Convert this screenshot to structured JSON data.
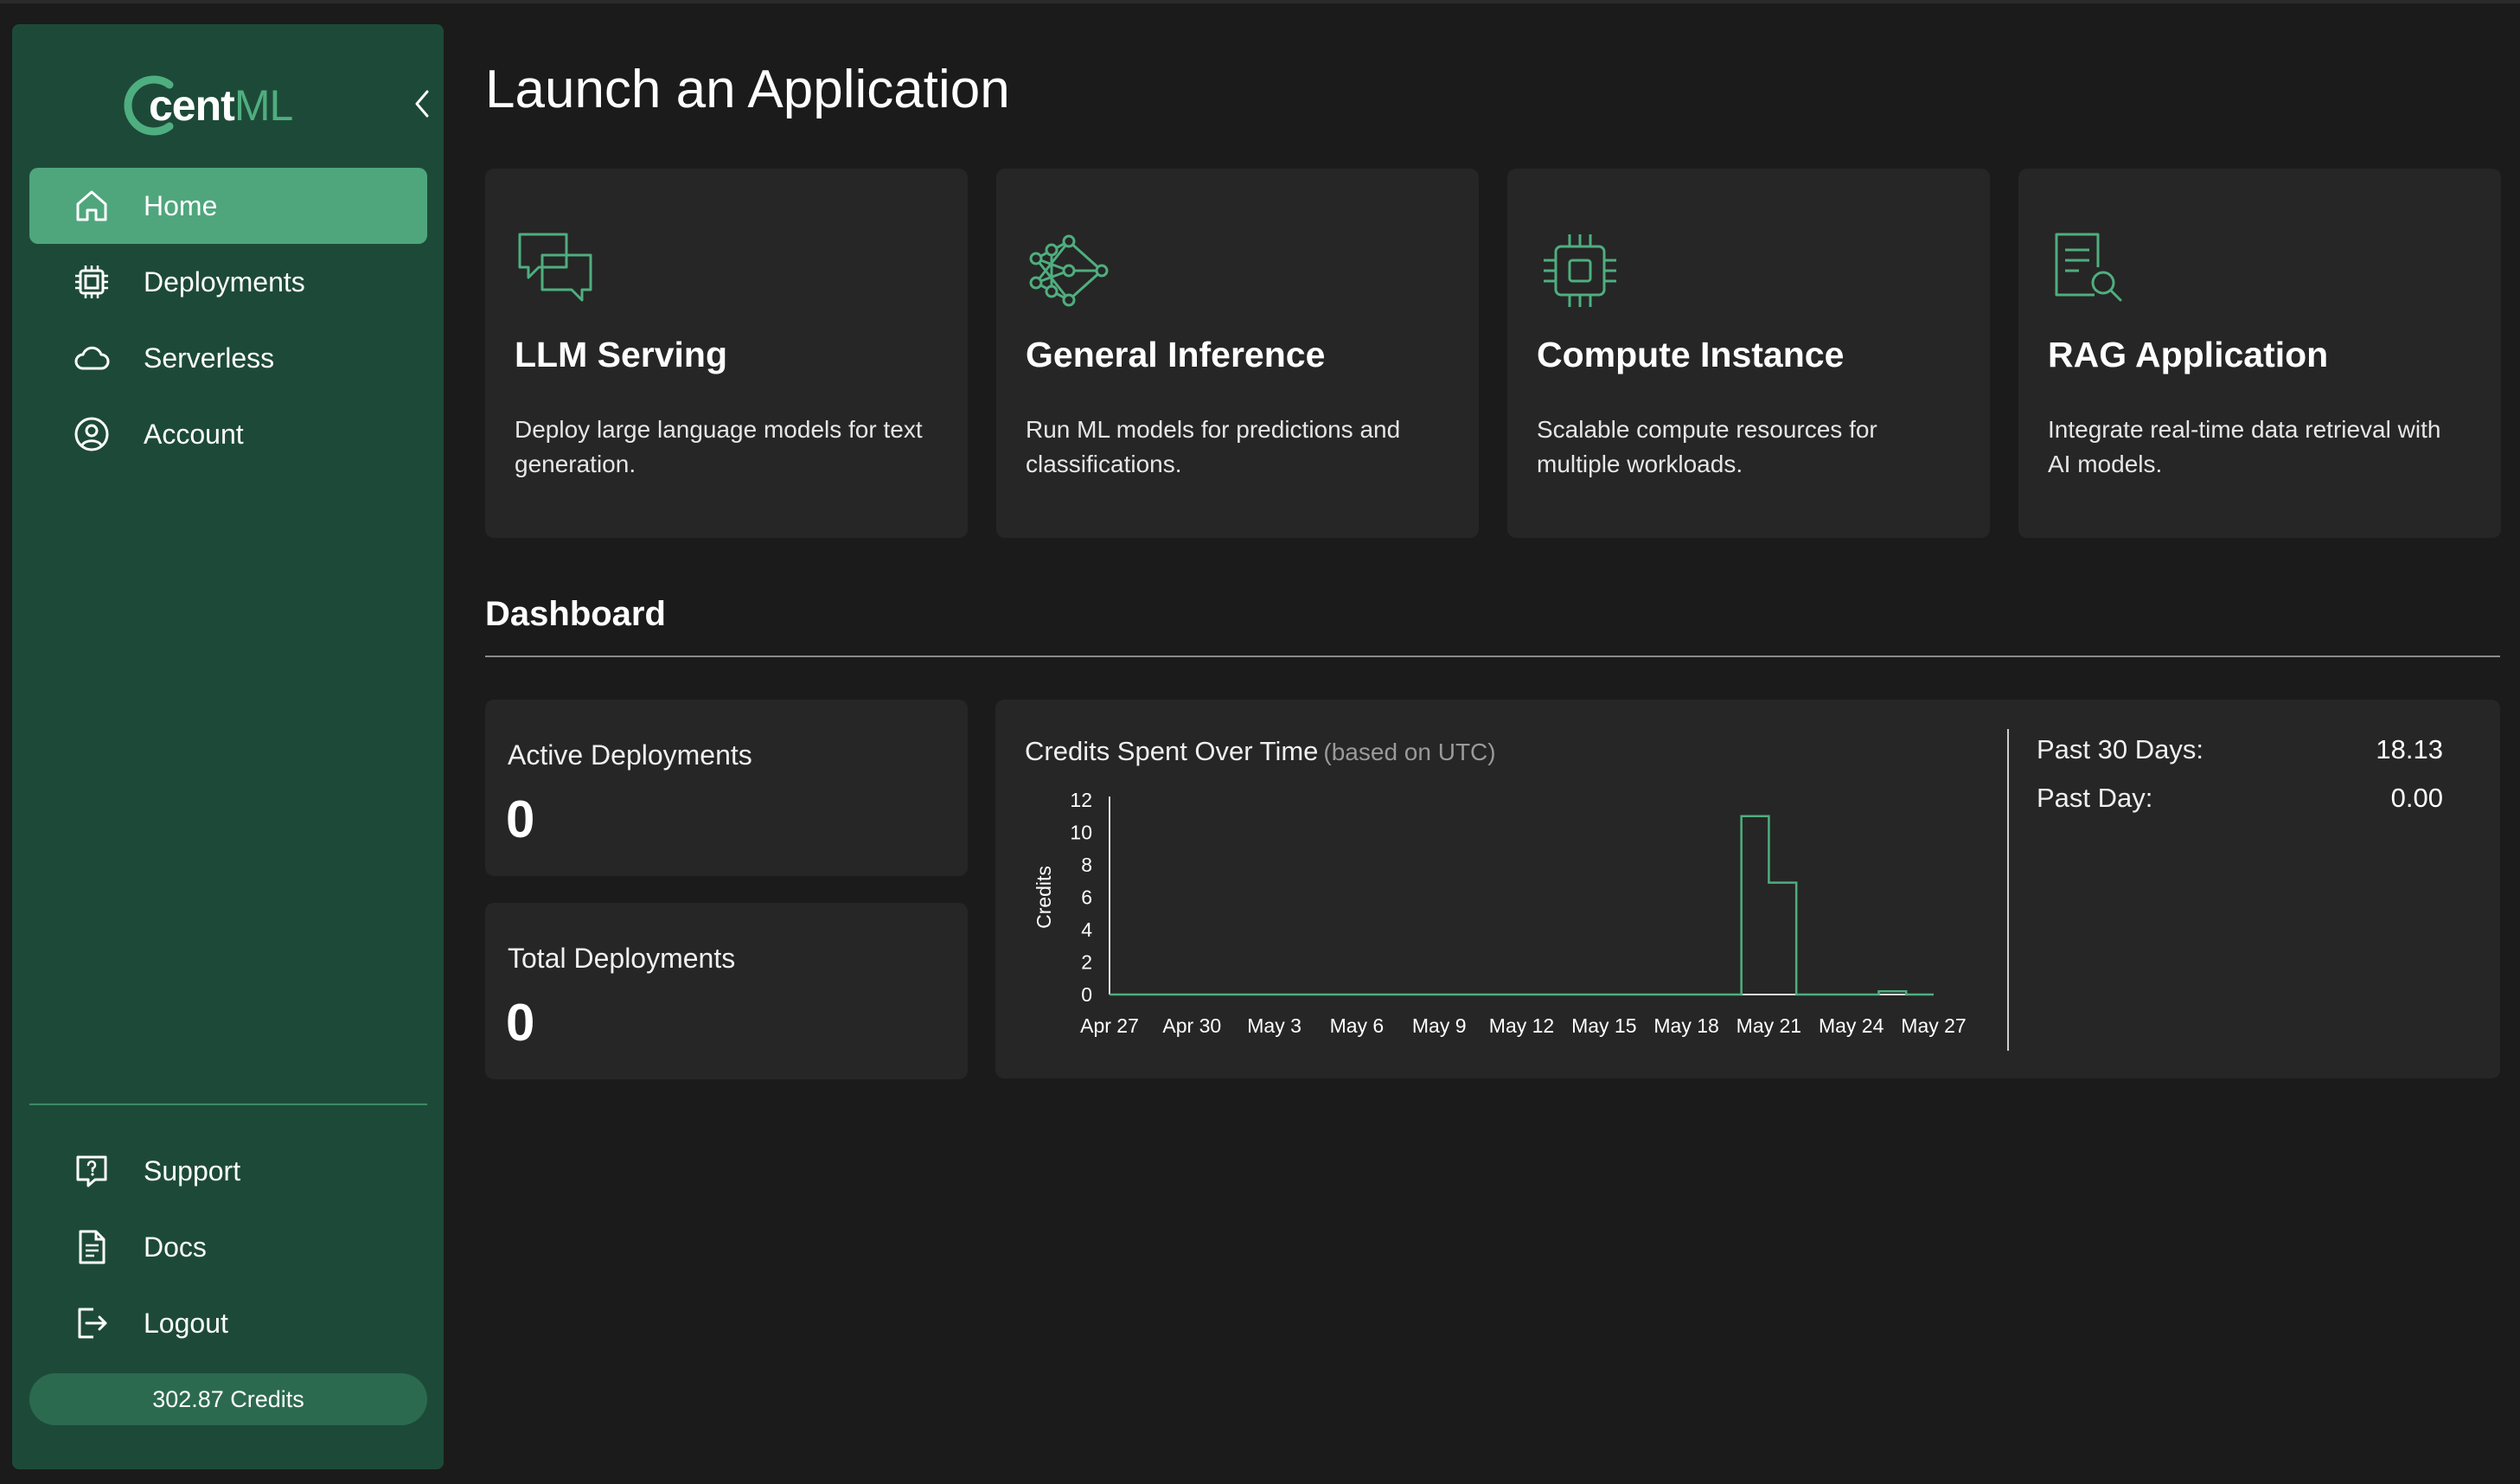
{
  "sidebar": {
    "logo": {
      "cent": "cent",
      "ml": "ML"
    },
    "nav_top": [
      {
        "label": "Home",
        "icon": "home-icon",
        "active": true
      },
      {
        "label": "Deployments",
        "icon": "chip-icon",
        "active": false
      },
      {
        "label": "Serverless",
        "icon": "cloud-icon",
        "active": false
      },
      {
        "label": "Account",
        "icon": "user-circle-icon",
        "active": false
      }
    ],
    "nav_bottom": [
      {
        "label": "Support",
        "icon": "help-chat-icon"
      },
      {
        "label": "Docs",
        "icon": "document-icon"
      },
      {
        "label": "Logout",
        "icon": "logout-icon"
      }
    ],
    "credits": "302.87 Credits"
  },
  "main": {
    "title": "Launch an Application",
    "cards": [
      {
        "title": "LLM Serving",
        "description": "Deploy large language models for text generation.",
        "icon": "chat-bubbles-icon"
      },
      {
        "title": "General Inference",
        "description": "Run ML models for predictions and classifications.",
        "icon": "neural-network-icon"
      },
      {
        "title": "Compute Instance",
        "description": "Scalable compute resources for multiple workloads.",
        "icon": "cpu-icon"
      },
      {
        "title": "RAG Application",
        "description": "Integrate real-time data retrieval with AI models.",
        "icon": "document-search-icon"
      }
    ]
  },
  "dashboard": {
    "title": "Dashboard",
    "active_deployments": {
      "label": "Active Deployments",
      "value": "0"
    },
    "total_deployments": {
      "label": "Total Deployments",
      "value": "0"
    },
    "chart_title": "Credits Spent Over Time",
    "chart_subtitle": "(based on UTC)",
    "summary": [
      {
        "label": "Past 30 Days:",
        "value": "18.13"
      },
      {
        "label": "Past Day:",
        "value": "0.00"
      }
    ]
  },
  "colors": {
    "sidebar_bg": "#1d4a38",
    "accent": "#4fa67d",
    "card_bg": "#262626",
    "page_bg": "#1b1b1b",
    "line": "#4fae7f"
  },
  "chart_data": {
    "type": "line",
    "step": true,
    "ylabel": "Credits",
    "xlabel": "",
    "ylim": [
      0,
      12
    ],
    "yticks": [
      "0",
      "2",
      "4",
      "6",
      "8",
      "10",
      "12"
    ],
    "xticks": [
      "Apr 27",
      "Apr 30",
      "May 3",
      "May 6",
      "May 9",
      "May 12",
      "May 15",
      "May 18",
      "May 21",
      "May 24",
      "May 27"
    ],
    "xlim": [
      "2024-04-27",
      "2024-05-27"
    ],
    "series": [
      {
        "points": [
          {
            "x": "2024-04-27",
            "y": 0
          },
          {
            "x": "2024-05-20",
            "y": 11
          },
          {
            "x": "2024-05-21",
            "y": 6.9
          },
          {
            "x": "2024-05-22",
            "y": 0
          },
          {
            "x": "2024-05-25",
            "y": 0.2
          },
          {
            "x": "2024-05-26",
            "y": 0
          },
          {
            "x": "2024-05-27",
            "y": 0
          }
        ]
      }
    ]
  }
}
